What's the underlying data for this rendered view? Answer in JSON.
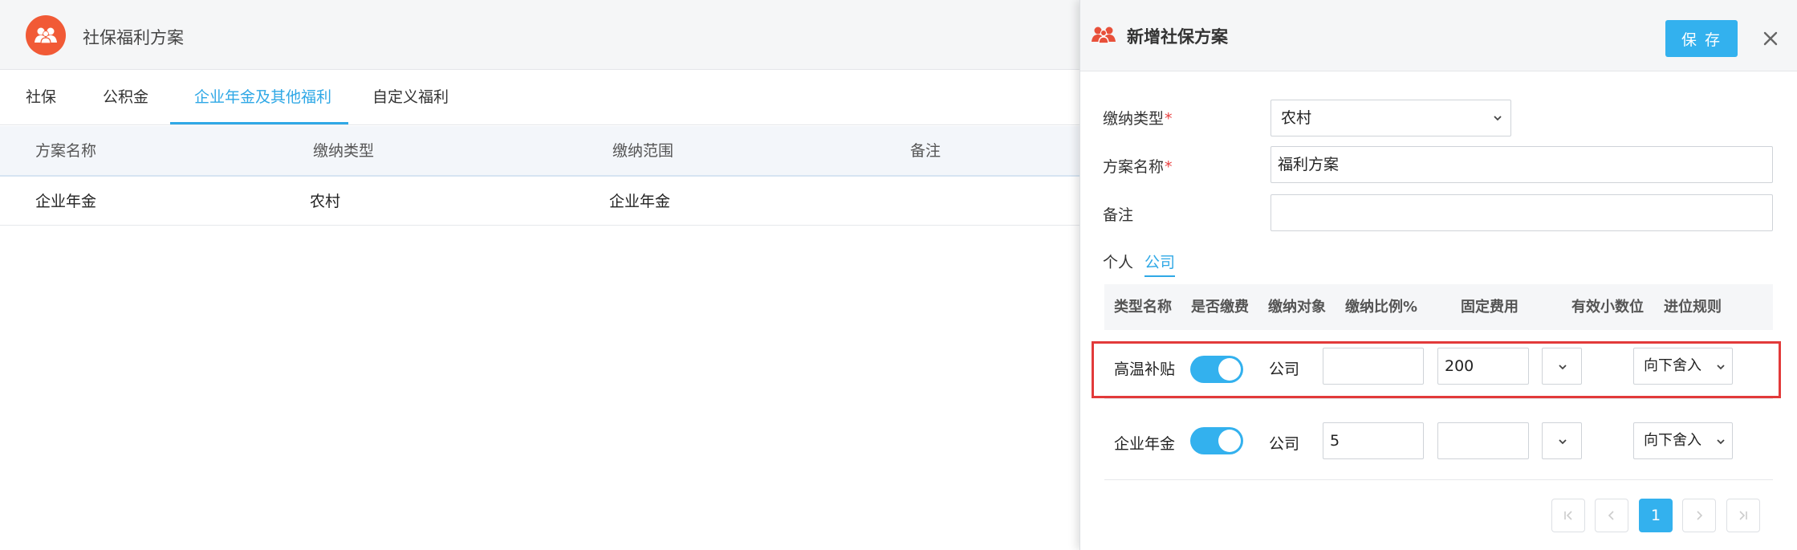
{
  "app": {
    "title": "社保福利方案",
    "logo_icon": "people-icon",
    "accent": "#f15a36"
  },
  "tabs": [
    {
      "label": "社保",
      "active": false
    },
    {
      "label": "公积金",
      "active": false
    },
    {
      "label": "企业年金及其他福利",
      "active": true
    },
    {
      "label": "自定义福利",
      "active": false
    }
  ],
  "table": {
    "columns": [
      "方案名称",
      "缴纳类型",
      "缴纳范围",
      "备注"
    ],
    "rows": [
      [
        "企业年金",
        "农村",
        "企业年金",
        ""
      ]
    ]
  },
  "drawer": {
    "title": "新增社保方案",
    "title_icon": "people-icon",
    "save_label": "保 存",
    "close_icon": "close-icon",
    "form": {
      "type_label": "缴纳类型",
      "type_value": "农村",
      "name_label": "方案名称",
      "name_value": "福利方案",
      "remark_label": "备注",
      "remark_value": "",
      "required_mark": "*"
    },
    "subtabs": [
      {
        "label": "个人",
        "active": false
      },
      {
        "label": "公司",
        "active": true
      }
    ],
    "grid": {
      "columns": [
        "类型名称",
        "是否缴费",
        "缴纳对象",
        "缴纳比例%",
        "固定费用",
        "有效小数位",
        "进位规则"
      ],
      "rows": [
        {
          "name": "高温补贴",
          "enabled": true,
          "target": "公司",
          "ratio": "",
          "fixed": "200",
          "decimals": "",
          "rounding": "向下舍入",
          "highlighted": true
        },
        {
          "name": "企业年金",
          "enabled": true,
          "target": "公司",
          "ratio": "5",
          "fixed": "",
          "decimals": "",
          "rounding": "向下舍入",
          "highlighted": false
        }
      ]
    },
    "pager": {
      "current": "1"
    }
  },
  "colors": {
    "primary": "#33b1ee",
    "tab_active": "#2fa8e6",
    "highlight": "#e23a3a",
    "required": "#e94040"
  }
}
